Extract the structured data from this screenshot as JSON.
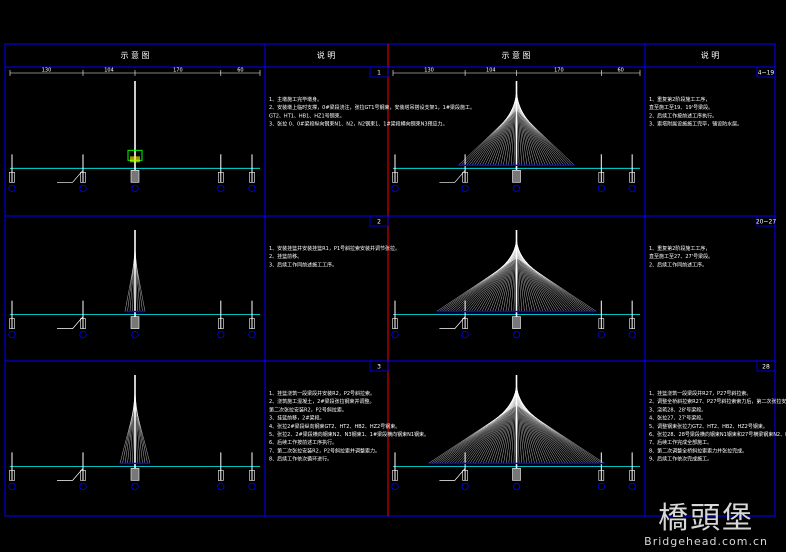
{
  "headers": {
    "diagram": "示 意 图",
    "notes": "说 明"
  },
  "span_dims": [
    "130",
    "104",
    "170",
    "60"
  ],
  "panels": [
    {
      "id": "1",
      "stage": 1
    },
    {
      "id": "2",
      "stage": 2
    },
    {
      "id": "3",
      "stage": 3
    },
    {
      "id": "4~19",
      "stage": 4
    },
    {
      "id": "20~27",
      "stage": 5
    },
    {
      "id": "28",
      "stage": 6
    }
  ],
  "notes": {
    "1": [
      "1、主墩施工完毕墩身。",
      "2、安装墩上临时支撑，0#梁段浇注，张拉GT1号钢束，安装塔吊搭设支架1，1#梁段施工。",
      "GT2、HT1、HB1、HZ1号钢束。",
      "3、张拉 0、0#梁段纵向钢束N1、N2，N2钢束1、1#梁段横向钢束N3预应力。"
    ],
    "2": [
      "1、安装挂篮并安装挂篮R1，P1号斜拉索安装并调节张拉。",
      "2、挂篮前移。",
      "3、后续工作同前述施工工序。"
    ],
    "3": [
      "1、挂篮浇筑一段梁段并安装R2，P2号斜拉索。",
      "2、浇筑施工混凝土，2#梁段张拉钢束并调整。",
      "第二次张拉安装R2，P2号斜拉索。",
      "3、挂篮前移，2#梁段。",
      "4、张拉2#梁段纵向钢束GT2、HT2、HB2、HZ2号钢束。",
      "5、张拉2、2#梁段横向钢束N2、N3钢束1、1#梁段横向钢束N1钢束。",
      "6、后续工作按前述工序执行。",
      "7、第二次张拉安装R2，P2号斜拉索并调整索力。",
      "8、后续工作依次循环进行。"
    ],
    "4~19": [
      "1、重复第2阶段施工工序，",
      "直至施工至19、19'号梁段。",
      "2、后续工作按前述工序执行。",
      "3、索塔附属设施施工完毕，铺设防水层。"
    ],
    "20~27": [
      "1、重复第2阶段施工工序，",
      "直至施工至27、27'号梁段。",
      "2、后续工作同前述工序。"
    ],
    "28": [
      "1、挂篮浇筑一段梁段并R27，P27号斜拉索。",
      "2、调整全桥斜拉索R27、P27号斜拉索索力后，第二次张拉安装R27、P27号斜拉索。",
      "3、浇筑28、28'号梁段。",
      "4、张拉27、27'号梁段。",
      "5、调整钢束张拉力GT2、HT2、HB2、HZ2号钢束。",
      "6、张拉28、28号梁段横向钢束N1钢束和27号横梁钢束N2、N3钢束以及27号梁段横向钢束N1钢束。",
      "7、后续工作完成全部施工。",
      "8、第二次调整全桥斜拉索索力并张拉完成。",
      "9、后续工作依次完成施工。"
    ]
  },
  "pier_marks": [
    "⑬",
    "⑭",
    "⑮",
    "⑯"
  ],
  "watermark": {
    "title": "橋頭堡",
    "url": "Bridgehead.com.cn"
  },
  "colors": {
    "frame": "#0000ff",
    "tower": "#ffffff",
    "deck": "#00ffff",
    "cable": "#ffffff",
    "struct": "#ffffff",
    "accent": "#ff0000",
    "green": "#00ff00",
    "yellow": "#ffff00"
  }
}
